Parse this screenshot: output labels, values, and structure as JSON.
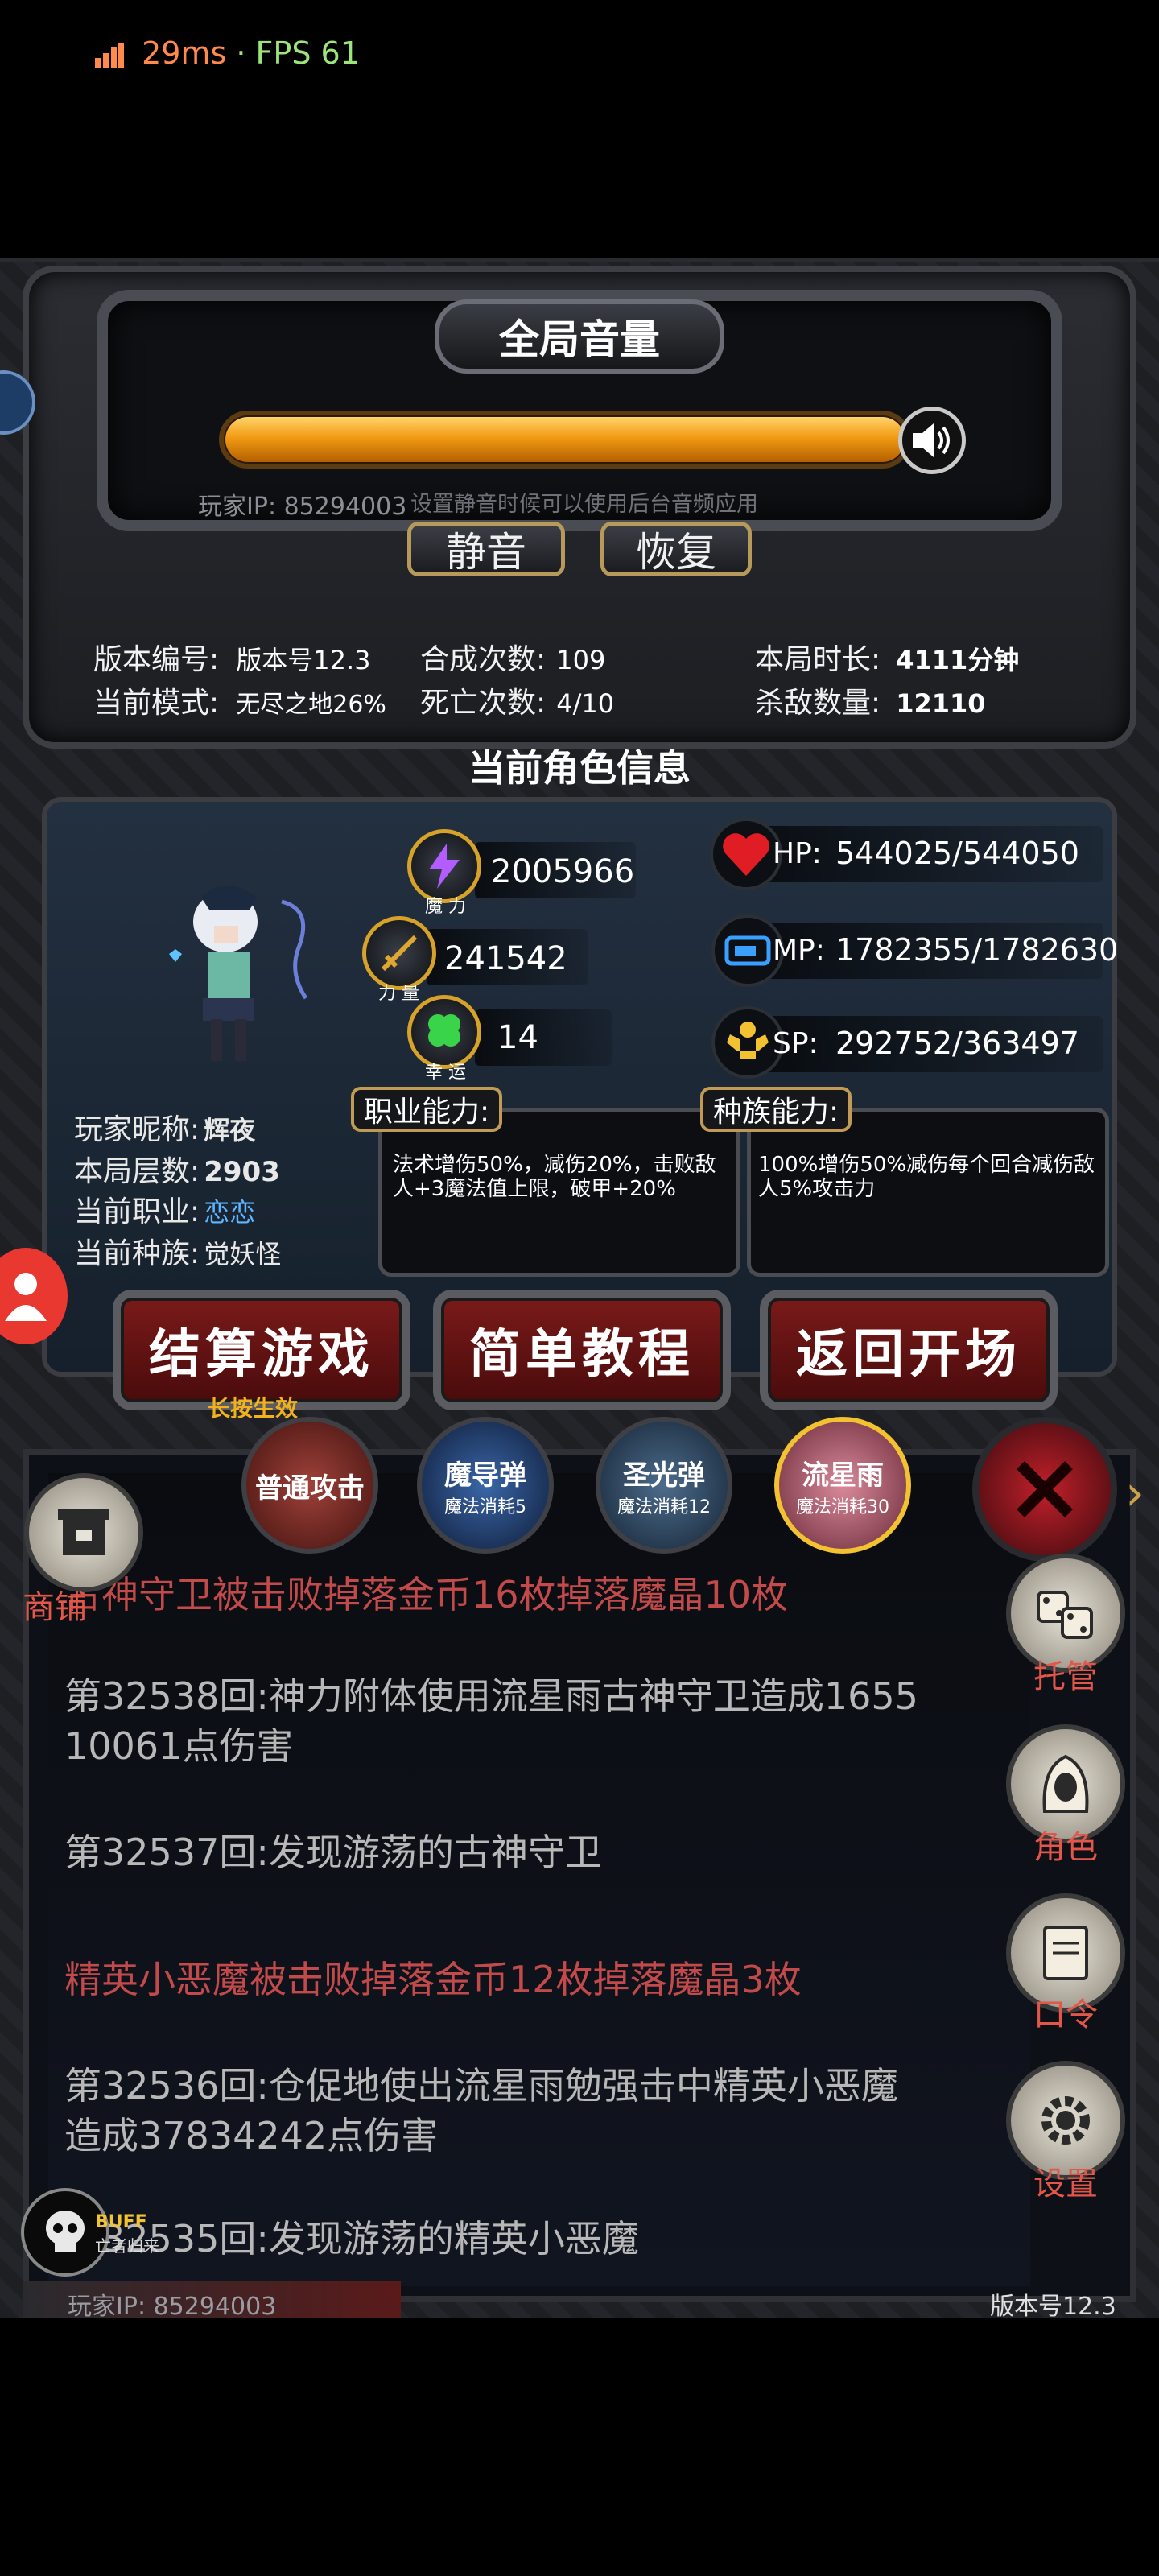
{
  "status_bar": {
    "latency": "29ms",
    "separator": "·",
    "fps": "FPS 61"
  },
  "volume": {
    "title": "全局音量",
    "level_percent": 100,
    "player_ip_label": "玩家IP:",
    "player_ip": "85294003",
    "hint": "设置静音时候可以使用后台音频应用",
    "mute_label": "静音",
    "restore_label": "恢复"
  },
  "stats": {
    "version_label": "版本编号:",
    "version_value": "版本号12.3",
    "mode_label": "当前模式:",
    "mode_value": "无尽之地26%",
    "craft_label": "合成次数:",
    "craft_value": "109",
    "death_label": "死亡次数:",
    "death_value": "4/10",
    "duration_label": "本局时长:",
    "duration_value": "4111分钟",
    "kills_label": "杀敌数量:",
    "kills_value": "12110"
  },
  "character": {
    "section_title": "当前角色信息",
    "magic_value": "2005966",
    "magic_caption": "魔 力",
    "power_value": "241542",
    "power_caption": "力 量",
    "luck_value": "14",
    "luck_caption": "幸 运",
    "hp_label": "HP:",
    "hp_value": "544025/544050",
    "mp_label": "MP:",
    "mp_value": "1782355/1782630",
    "sp_label": "SP:",
    "sp_value": "292752/363497",
    "nickname_label": "玩家昵称:",
    "nickname_value": "辉夜",
    "floor_label": "本局层数:",
    "floor_value": "2903",
    "job_label": "当前职业:",
    "job_value": "恋恋",
    "race_label": "当前种族:",
    "race_value": "觉妖怪",
    "job_ability_tag": "职业能力:",
    "job_ability_text": "法术增伤50%，减伤20%，击败敌人+3魔法值上限，破甲+20%",
    "race_ability_tag": "种族能力:",
    "race_ability_text": "100%增伤50%减伤每个回合减伤敌人5%攻击力"
  },
  "buttons": {
    "settle": "结算游戏",
    "settle_hint": "长按生效",
    "tutorial": "简单教程",
    "back": "返回开场"
  },
  "skills": [
    {
      "name": "普通攻击",
      "cost": ""
    },
    {
      "name": "魔导弹",
      "cost": "魔法消耗5"
    },
    {
      "name": "圣光弹",
      "cost": "魔法消耗12"
    },
    {
      "name": "流星雨",
      "cost": "魔法消耗30"
    }
  ],
  "log": [
    {
      "text": "古神守卫被击败掉落金币16枚掉落魔晶10枚",
      "color": "red"
    },
    {
      "text": "第32538回:神力附体使用流星雨古神守卫造成1655",
      "color": "grey"
    },
    {
      "text": "10061点伤害",
      "color": "grey"
    },
    {
      "text": "第32537回:发现游荡的古神守卫",
      "color": "grey"
    },
    {
      "text": "精英小恶魔被击败掉落金币12枚掉落魔晶3枚",
      "color": "red"
    },
    {
      "text": "第32536回:仓促地使出流星雨勉强击中精英小恶魔",
      "color": "grey"
    },
    {
      "text": "造成37834242点伤害",
      "color": "grey"
    },
    {
      "text": "第32535回:发现游荡的精英小恶魔",
      "color": "grey"
    }
  ],
  "side_menu": {
    "shop": "商铺",
    "auto": "托管",
    "role": "角色",
    "code": "口令",
    "settings": "设置"
  },
  "buff": {
    "label": "BUFF",
    "name": "亡者归来"
  },
  "footer": {
    "ip_label": "玩家IP:",
    "ip": "85294003",
    "version": "版本号12.3"
  },
  "colors": {
    "accent_gold": "#d6a22a",
    "danger_red": "#c24a4a",
    "bar_orange": "#f29b14"
  }
}
